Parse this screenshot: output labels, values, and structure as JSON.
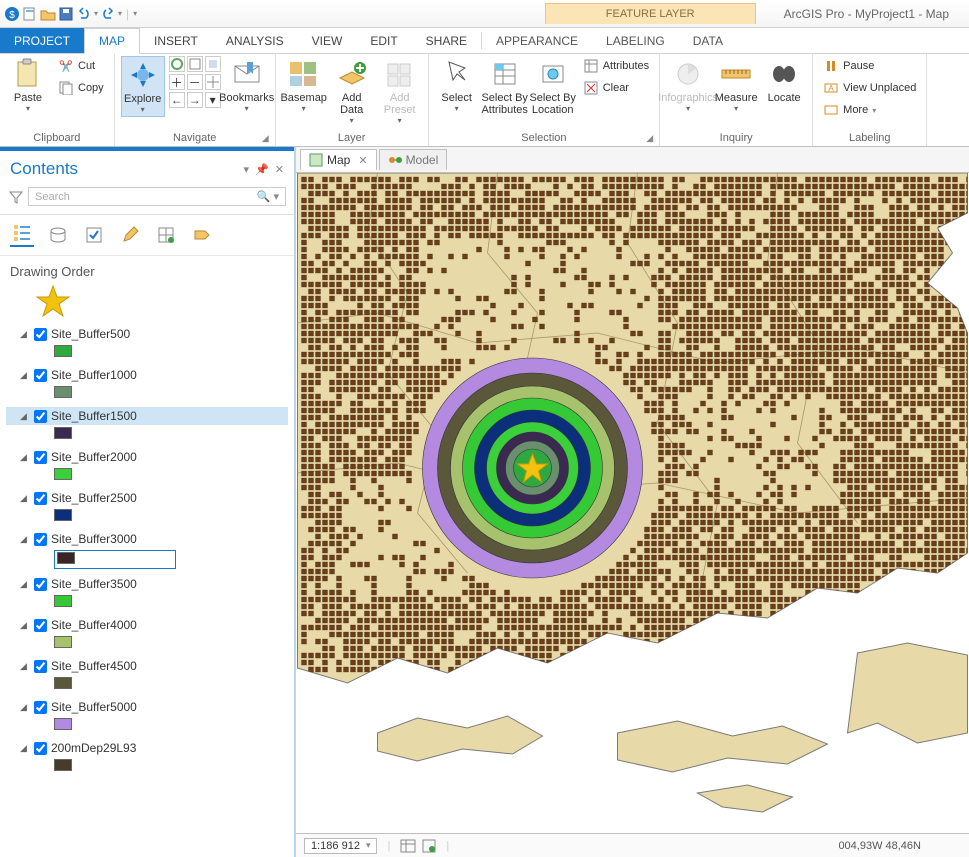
{
  "app_title": "ArcGIS Pro - MyProject1 - Map",
  "feature_layer_label": "FEATURE LAYER",
  "tabs": {
    "project": "PROJECT",
    "map": "MAP",
    "insert": "INSERT",
    "analysis": "ANALYSIS",
    "view": "VIEW",
    "edit": "EDIT",
    "share": "SHARE",
    "appearance": "APPEARANCE",
    "labeling": "LABELING",
    "data": "DATA"
  },
  "ribbon": {
    "clipboard": {
      "label": "Clipboard",
      "paste": "Paste",
      "cut": "Cut",
      "copy": "Copy"
    },
    "navigate": {
      "label": "Navigate",
      "explore": "Explore",
      "bookmarks": "Bookmarks"
    },
    "layer": {
      "label": "Layer",
      "basemap": "Basemap",
      "add_data": "Add Data",
      "add_preset": "Add Preset"
    },
    "selection": {
      "label": "Selection",
      "select": "Select",
      "by_attributes": "Select By Attributes",
      "by_location": "Select By Location",
      "attributes": "Attributes",
      "clear": "Clear"
    },
    "inquiry": {
      "label": "Inquiry",
      "infographics": "Infographics",
      "measure": "Measure",
      "locate": "Locate"
    },
    "labeling": {
      "label": "Labeling",
      "pause": "Pause",
      "view_unplaced": "View Unplaced",
      "more": "More"
    }
  },
  "contents": {
    "title": "Contents",
    "search_placeholder": "Search",
    "drawing_order": "Drawing Order",
    "layers": [
      {
        "name": "Site_Buffer500",
        "color": "#2fa83f",
        "selected": false
      },
      {
        "name": "Site_Buffer1000",
        "color": "#6a8f6f",
        "selected": false
      },
      {
        "name": "Site_Buffer1500",
        "color": "#3a2950",
        "selected": true
      },
      {
        "name": "Site_Buffer2000",
        "color": "#3ccf3c",
        "selected": false
      },
      {
        "name": "Site_Buffer2500",
        "color": "#0b2f7a",
        "selected": false
      },
      {
        "name": "Site_Buffer3000",
        "color": "#3a2424",
        "selected": false,
        "boxed": true
      },
      {
        "name": "Site_Buffer3500",
        "color": "#36c936",
        "selected": false
      },
      {
        "name": "Site_Buffer4000",
        "color": "#a6c26c",
        "selected": false
      },
      {
        "name": "Site_Buffer4500",
        "color": "#5a573b",
        "selected": false
      },
      {
        "name": "Site_Buffer5000",
        "color": "#b38ae0",
        "selected": false
      },
      {
        "name": "200mDep29L93",
        "color": "#4a3a2a",
        "selected": false
      }
    ]
  },
  "map_tabs": {
    "map": "Map",
    "model": "Model"
  },
  "status": {
    "scale": "1:186 912",
    "coords": "004,93W 48,46N"
  },
  "map": {
    "land_fill": "#e8d9a8",
    "land_stroke": "#7a7a7a",
    "points_fill": "#6b3f1a",
    "star_color": "#f3c20e",
    "rings": [
      {
        "r": 110,
        "fill": "#b38ae0"
      },
      {
        "r": 95,
        "fill": "#5a573b"
      },
      {
        "r": 82,
        "fill": "#a6c26c"
      },
      {
        "r": 70,
        "fill": "#36c936"
      },
      {
        "r": 58,
        "fill": "#0b2f7a"
      },
      {
        "r": 46,
        "fill": "#3ccf3c"
      },
      {
        "r": 36,
        "fill": "#3a2950"
      },
      {
        "r": 27,
        "fill": "#6a8f6f"
      },
      {
        "r": 19,
        "fill": "#2fa83f"
      }
    ]
  }
}
